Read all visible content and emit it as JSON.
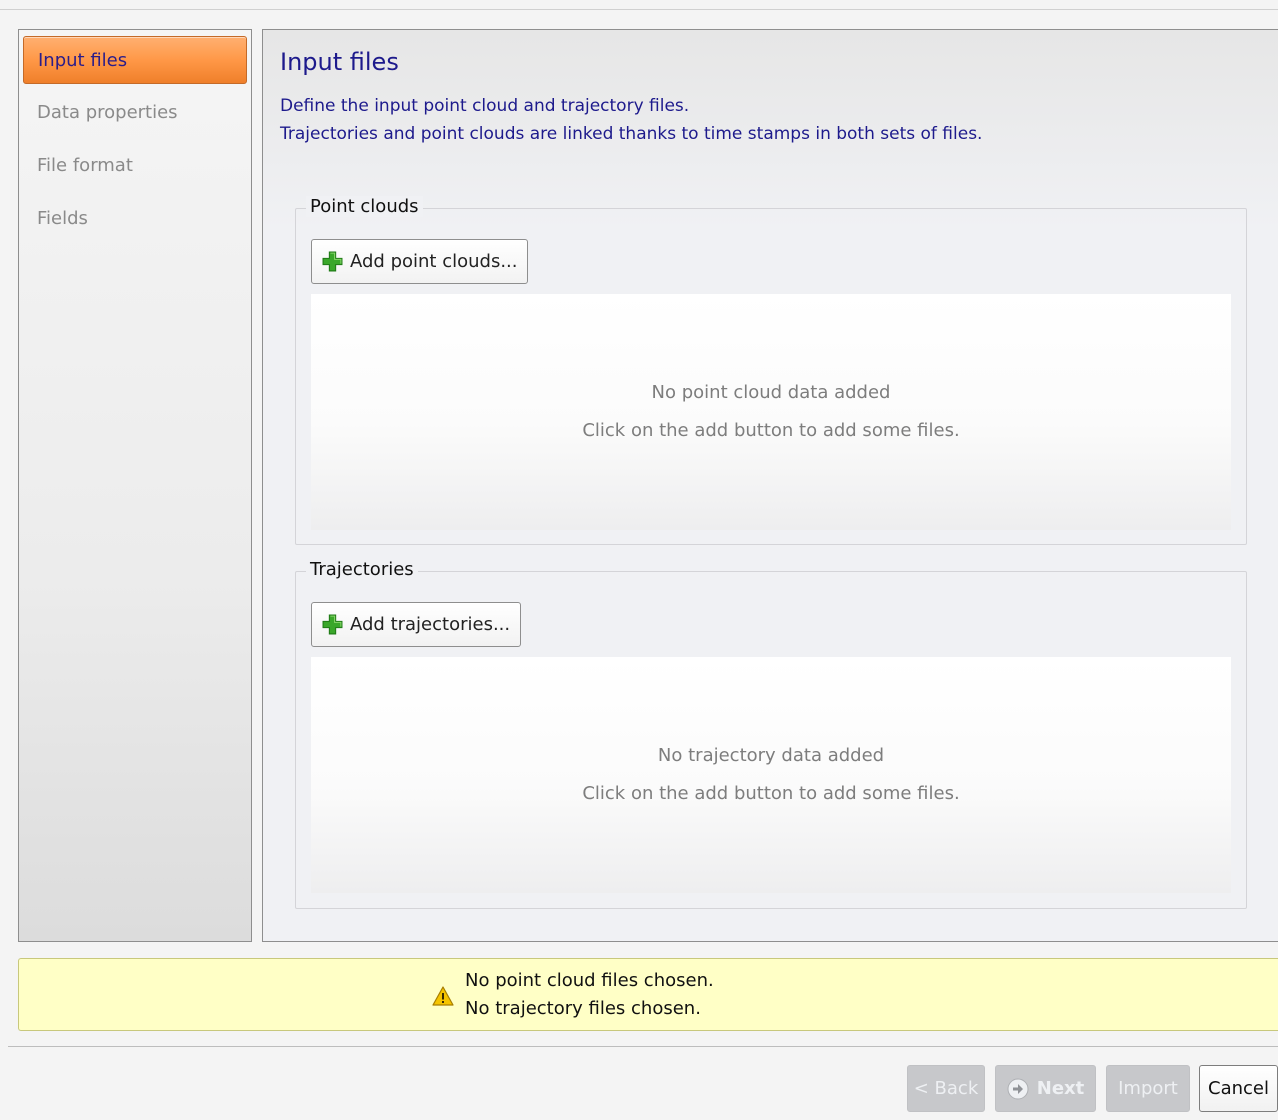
{
  "sidebar": {
    "items": [
      {
        "label": "Input files",
        "active": true
      },
      {
        "label": "Data properties",
        "active": false
      },
      {
        "label": "File format",
        "active": false
      },
      {
        "label": "Fields",
        "active": false
      }
    ]
  },
  "main": {
    "title": "Input files",
    "description": [
      "Define the input point cloud and trajectory files.",
      "Trajectories and point clouds are linked thanks to time stamps in both sets of files."
    ],
    "point_clouds": {
      "group_title": "Point clouds",
      "add_label": "Add point clouds...",
      "empty_title": "No point cloud data added",
      "empty_hint": "Click on the add button to add some files."
    },
    "trajectories": {
      "group_title": "Trajectories",
      "add_label": "Add trajectories...",
      "empty_title": "No trajectory data added",
      "empty_hint": "Click on the add button to add some files."
    }
  },
  "warning": {
    "icon": "warning-icon",
    "lines": [
      "No point cloud files chosen.",
      "No trajectory files chosen."
    ]
  },
  "buttons": {
    "back": "< Back",
    "next": "Next",
    "import": "Import",
    "cancel": "Cancel"
  },
  "colors": {
    "accent_orange": "#ff9847",
    "title_blue": "#1d1a8c",
    "warning_bg": "#ffffc6",
    "plus_green": "#3aa72a"
  }
}
